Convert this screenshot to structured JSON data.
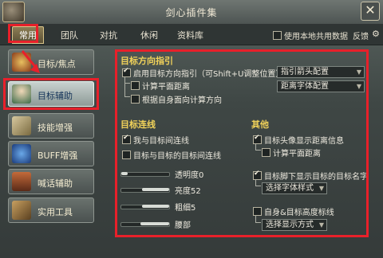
{
  "window": {
    "title": "剑心插件集",
    "close_label": "✕"
  },
  "tabs": [
    {
      "label": "常用",
      "active": true
    },
    {
      "label": "团队"
    },
    {
      "label": "对抗"
    },
    {
      "label": "休闲"
    },
    {
      "label": "资料库"
    }
  ],
  "topbar": {
    "share_label": "使用本地共用数据",
    "share_checked": false,
    "feedback_label": "反馈"
  },
  "sidebar": {
    "items": [
      {
        "label": "目标/焦点",
        "icon": "target-icon"
      },
      {
        "label": "目标辅助",
        "icon": "character-icon",
        "active": true
      },
      {
        "label": "技能增强",
        "icon": "skill-book-icon"
      },
      {
        "label": "BUFF增强",
        "icon": "buff-icon"
      },
      {
        "label": "喊话辅助",
        "icon": "shout-icon"
      },
      {
        "label": "实用工具",
        "icon": "tools-icon"
      }
    ]
  },
  "direction": {
    "title": "目标方向指引",
    "enable_label": "启用目标方向指引（可Shift+U调整位置）",
    "enable_checked": true,
    "flat_distance_label": "计算平面距离",
    "self_facing_label": "根据自身面向计算方向",
    "arrow_config_label": "指引箭头配置",
    "distance_font_label": "距离字体配置"
  },
  "connection": {
    "title": "目标连线",
    "me_target_label": "我与目标间连线",
    "me_target_checked": true,
    "target_target_label": "目标与目标的目标间连线",
    "target_target_checked": false,
    "sliders": [
      {
        "label": "透明度0",
        "value": 0
      },
      {
        "label": "亮度52",
        "value": 52
      },
      {
        "label": "粗细5",
        "value": 5
      },
      {
        "label": "腰部",
        "value": 0
      }
    ]
  },
  "other": {
    "title": "其他",
    "avatar_distance_label": "目标头像显示距离信息",
    "avatar_distance_checked": true,
    "flat_distance_label": "计算平面距离",
    "foot_name_label": "目标脚下显示目标的目标名字",
    "foot_name_checked": true,
    "font_style_label": "选择字体样式",
    "height_line_label": "自身&目标高度标线",
    "height_line_checked": false,
    "display_mode_label": "选择显示方式"
  },
  "colors": {
    "highlight": "#e8202a",
    "section_title": "#f2d35a"
  }
}
